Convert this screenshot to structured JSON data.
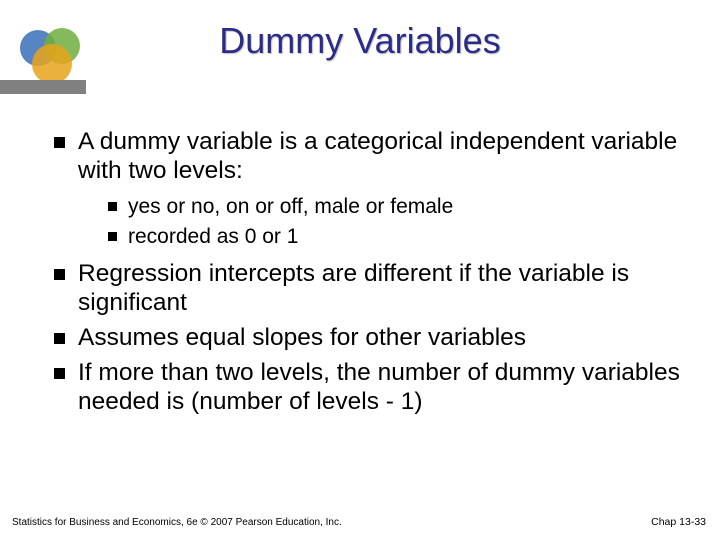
{
  "title": "Dummy Variables",
  "bullets": {
    "l1": [
      "A dummy variable is a categorical independent variable with two levels:",
      "Regression intercepts are different if the variable is significant",
      "Assumes equal slopes for other variables",
      "If more than two levels, the number of dummy variables needed is (number of levels - 1)"
    ],
    "l2": [
      "yes or no, on or off, male or female",
      "recorded as 0 or 1"
    ]
  },
  "footer": {
    "left": "Statistics for Business and Economics, 6e © 2007 Pearson Education, Inc.",
    "right": "Chap 13-33"
  }
}
